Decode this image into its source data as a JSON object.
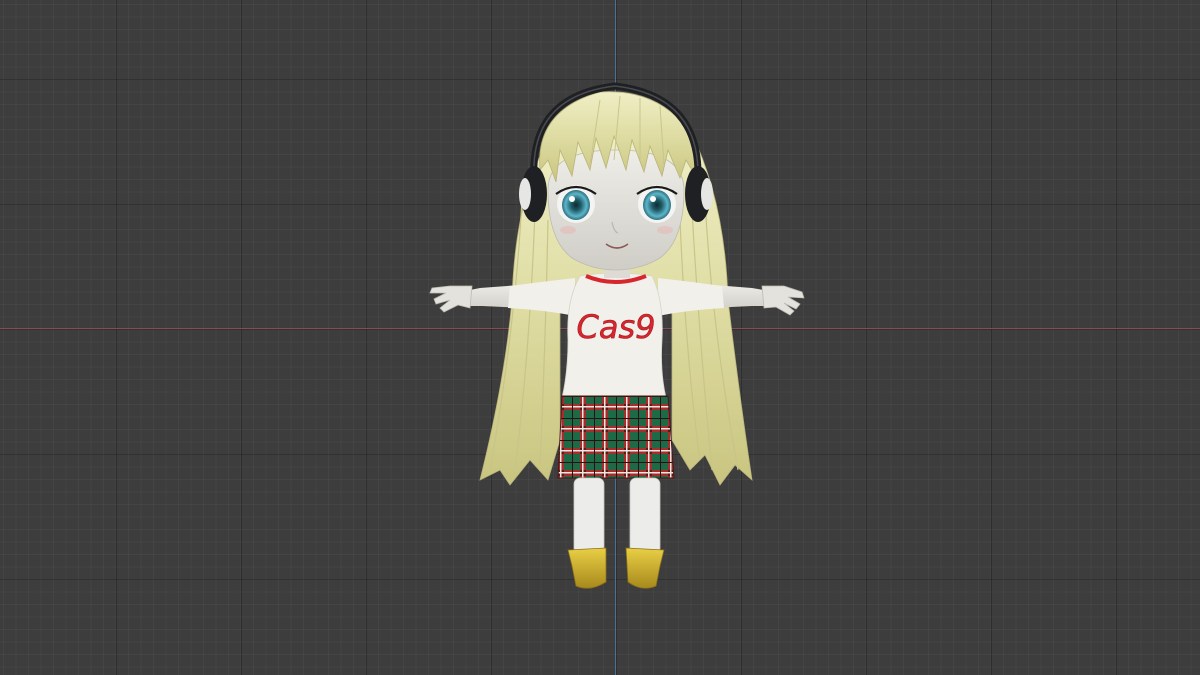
{
  "viewport": {
    "background": "#3d3d3d",
    "grid_minor": "#434343",
    "grid_major": "#2f2f2f",
    "axis_x_color": "#8a4a55",
    "axis_y_color": "#4a6ea0"
  },
  "character": {
    "shirt_text": "Cas9",
    "colors": {
      "hair": "#e3e1ab",
      "skin": "#e6e4de",
      "shirt": "#f2f0ea",
      "shirt_text": "#d8262e",
      "skirt_base": "#1e6b45",
      "skirt_check": "#b5332f",
      "socks": "#ececea",
      "shoes": "#d6b62a",
      "headphones": "#222326",
      "eyes": "#4aa0b8"
    }
  }
}
